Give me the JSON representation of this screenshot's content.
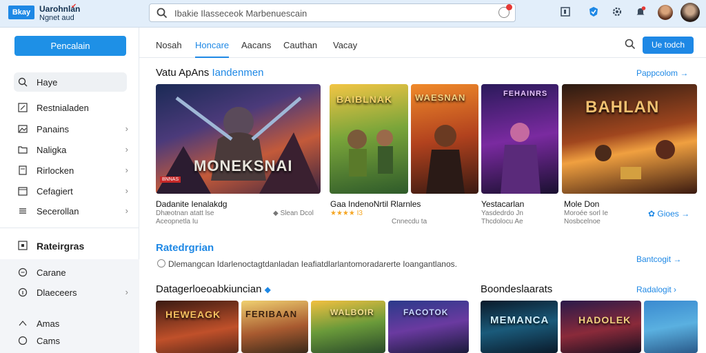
{
  "app": {
    "logo_text": "Bkay",
    "name": "Uarohnlan",
    "subtitle": "Ngnet aud"
  },
  "search": {
    "value": "Ibakie Ilasseceok Marbenuescain"
  },
  "sidebar": {
    "primary_button": "Pencalain",
    "items": [
      {
        "label": "Haye"
      },
      {
        "label": "Restnialaden"
      },
      {
        "label": "Panains"
      },
      {
        "label": "Naligka"
      },
      {
        "label": "Rirlocken"
      },
      {
        "label": "Cefagiert"
      },
      {
        "label": "Secerollan"
      }
    ],
    "section_heading": "Rateirgras",
    "bottom_items": [
      {
        "label": "Carane"
      },
      {
        "label": "Dlaeceers"
      },
      {
        "label": "Amas"
      },
      {
        "label": "Cams"
      }
    ]
  },
  "tabs": [
    "Nosah",
    "Honcare",
    "Aacans",
    "Cauthan",
    "Vacay"
  ],
  "header_button": "Ue todch",
  "featured": {
    "title_plain": "Vatu ApAns ",
    "title_accent": "Iandenmen",
    "link": "Pappcolom",
    "cards": [
      {
        "art_text": "MONEKSNAI",
        "badge": "BNNAS",
        "title": "Dadanite Ienalakdg",
        "meta": "Dhæotnan atatt lse",
        "meta2": "Aceopnetla Iu",
        "extra": "Slean Dcol"
      },
      {
        "art_text": "BAIBLNAK",
        "title": "Gaa IndenoNrtil Rlarnles",
        "meta": "★★★★ I3",
        "meta2": "Cnnecdu ta"
      },
      {
        "art_text": "WAESNAN",
        "title": "",
        "meta": "",
        "meta2": ""
      },
      {
        "art_text": "FEHAINRS",
        "title": "Yestacarlan",
        "meta": "Yasdedrdo Jn",
        "meta2": "Thcdolocu Ae"
      },
      {
        "art_text": "BAHLAN",
        "title": "Mole Don",
        "meta": "Moroée sorl Ie",
        "meta2": "Nosbcelnoe",
        "link": "Gioes"
      }
    ]
  },
  "category": {
    "title": "Ratedrgrian",
    "link": "Bantcogit",
    "description": "Dlemangcan Idarlenoctagtdanladan Ieafiatdlarlantomoradarerte Ioangantlanos."
  },
  "row_left": {
    "title": "Datagerloeoabkiuncian",
    "cards": [
      "HEWEAGK",
      "FERIBAAN",
      "WALBOIR",
      "FACOTOK"
    ]
  },
  "row_right": {
    "title": "Boondeslaarats",
    "link": "Radalogit",
    "cards": [
      "MEMANCA",
      "HADOLEK",
      ""
    ]
  },
  "colors": {
    "accent": "#1e88e5",
    "topbar": "#e2eefa"
  }
}
